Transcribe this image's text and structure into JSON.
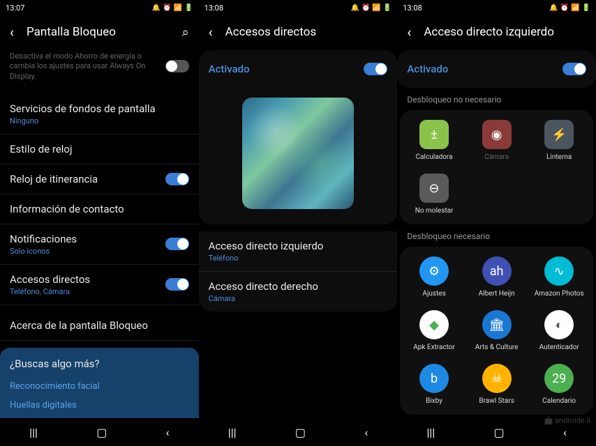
{
  "phone1": {
    "time": "13:07",
    "title": "Pantalla Bloqueo",
    "desc": "Desactiva el modo Ahorro de energía o cambia los ajustes para usar Always On Display.",
    "items": {
      "wallpaper": {
        "title": "Servicios de fondos de pantalla",
        "sub": "Ninguno"
      },
      "clock_style": {
        "title": "Estilo de reloj"
      },
      "roaming_clock": {
        "title": "Reloj de itinerancia"
      },
      "contact_info": {
        "title": "Información de contacto"
      },
      "notifications": {
        "title": "Notificaciones",
        "sub": "Solo iconos"
      },
      "shortcuts": {
        "title": "Accesos directos",
        "sub": "Teléfono, Cámara"
      },
      "about": {
        "title": "Acerca de la pantalla Bloqueo"
      }
    },
    "search_more": {
      "title": "¿Buscas algo más?",
      "links": [
        "Reconocimiento facial",
        "Huellas digitales"
      ]
    }
  },
  "phone2": {
    "time": "13:08",
    "title": "Accesos directos",
    "activated": "Activado",
    "left": {
      "title": "Acceso directo izquierdo",
      "sub": "Teléfono"
    },
    "right": {
      "title": "Acceso directo derecho",
      "sub": "Cámara"
    }
  },
  "phone3": {
    "time": "13:08",
    "title": "Acceso directo izquierdo",
    "activated": "Activado",
    "section1": "Desbloqueo no necesario",
    "section2": "Desbloqueo necesario",
    "apps_no_unlock": [
      {
        "label": "Calculadora",
        "color": "#8bc34a",
        "glyph": "±"
      },
      {
        "label": "Cámara",
        "color": "#8b3a3a",
        "glyph": "◉",
        "dim": true
      },
      {
        "label": "Linterna",
        "color": "#4a5560",
        "glyph": "⚡"
      },
      {
        "label": "No molestar",
        "color": "#5a5a5a",
        "glyph": "⊖"
      }
    ],
    "apps_unlock": [
      {
        "label": "Ajustes",
        "color": "#2196f3",
        "glyph": "⚙"
      },
      {
        "label": "Albert Heijn",
        "color": "#3f51b5",
        "glyph": "ah"
      },
      {
        "label": "Amazon Photos",
        "color": "#00bcd4",
        "glyph": "∿"
      },
      {
        "label": "Apk Extractor",
        "color": "#fff",
        "glyph": "◆",
        "textcolor": "#4caf50"
      },
      {
        "label": "Arts & Culture",
        "color": "#1976d2",
        "glyph": "🏛"
      },
      {
        "label": "Autenticador",
        "color": "#fff",
        "glyph": "◐",
        "textcolor": "#555"
      },
      {
        "label": "Bixby",
        "color": "#1e88e5",
        "glyph": "b"
      },
      {
        "label": "Brawl Stars",
        "color": "#ffb300",
        "glyph": "☠"
      },
      {
        "label": "Calendario",
        "color": "#4caf50",
        "glyph": "29"
      }
    ]
  },
  "watermark": "androide li"
}
